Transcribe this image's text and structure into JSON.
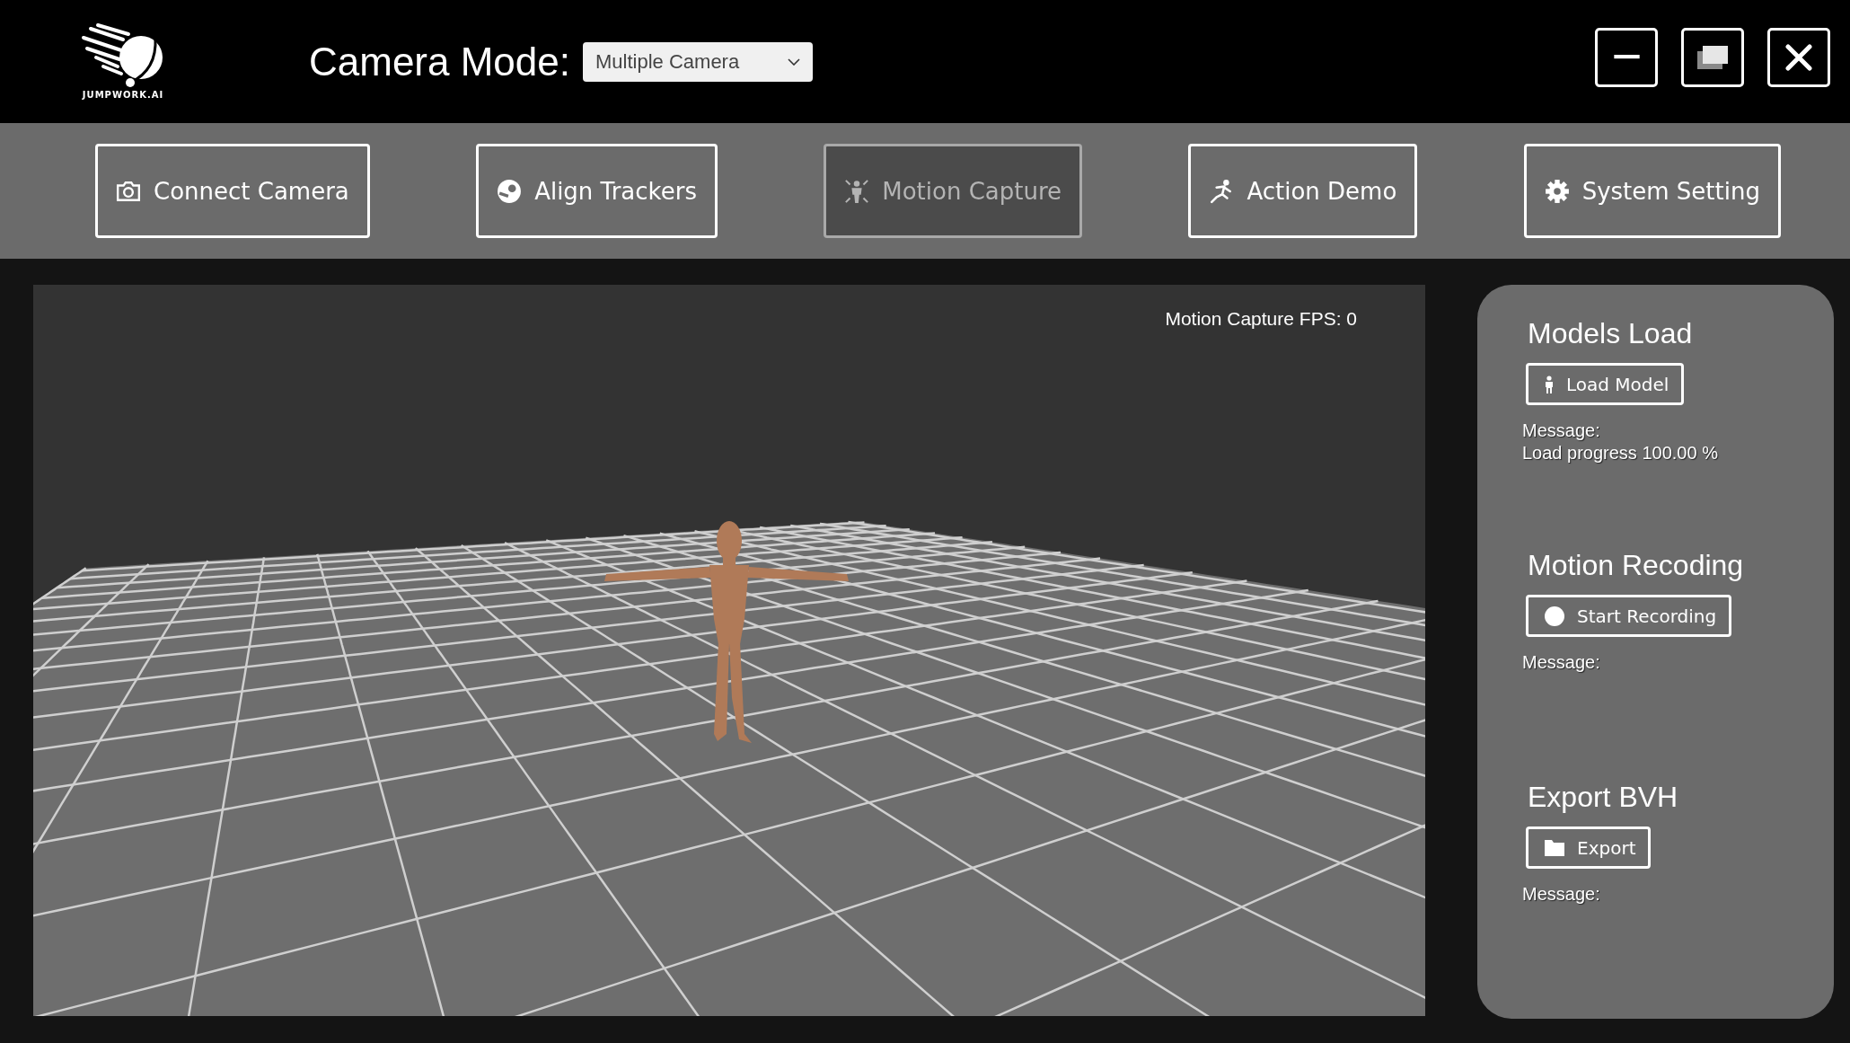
{
  "logo": {
    "text": "JUMPWORK.AI"
  },
  "header": {
    "label": "Camera Mode:",
    "dropdown": {
      "value": "Multiple Camera"
    }
  },
  "nav": [
    {
      "label": "Connect Camera",
      "selected": false
    },
    {
      "label": "Align Trackers",
      "selected": false
    },
    {
      "label": "Motion Capture",
      "selected": true
    },
    {
      "label": "Action Demo",
      "selected": false
    },
    {
      "label": "System Setting",
      "selected": false
    }
  ],
  "viewport": {
    "fps_label": "Motion Capture FPS: 0"
  },
  "panel": {
    "sections": [
      {
        "title": "Models Load",
        "button": "Load Model",
        "message_label": "Message:",
        "message": "Load progress 100.00 %"
      },
      {
        "title": "Motion Recoding",
        "button": "Start Recording",
        "message_label": "Message:"
      },
      {
        "title": "Export BVH",
        "button": "Export",
        "message_label": "Message:"
      }
    ]
  }
}
